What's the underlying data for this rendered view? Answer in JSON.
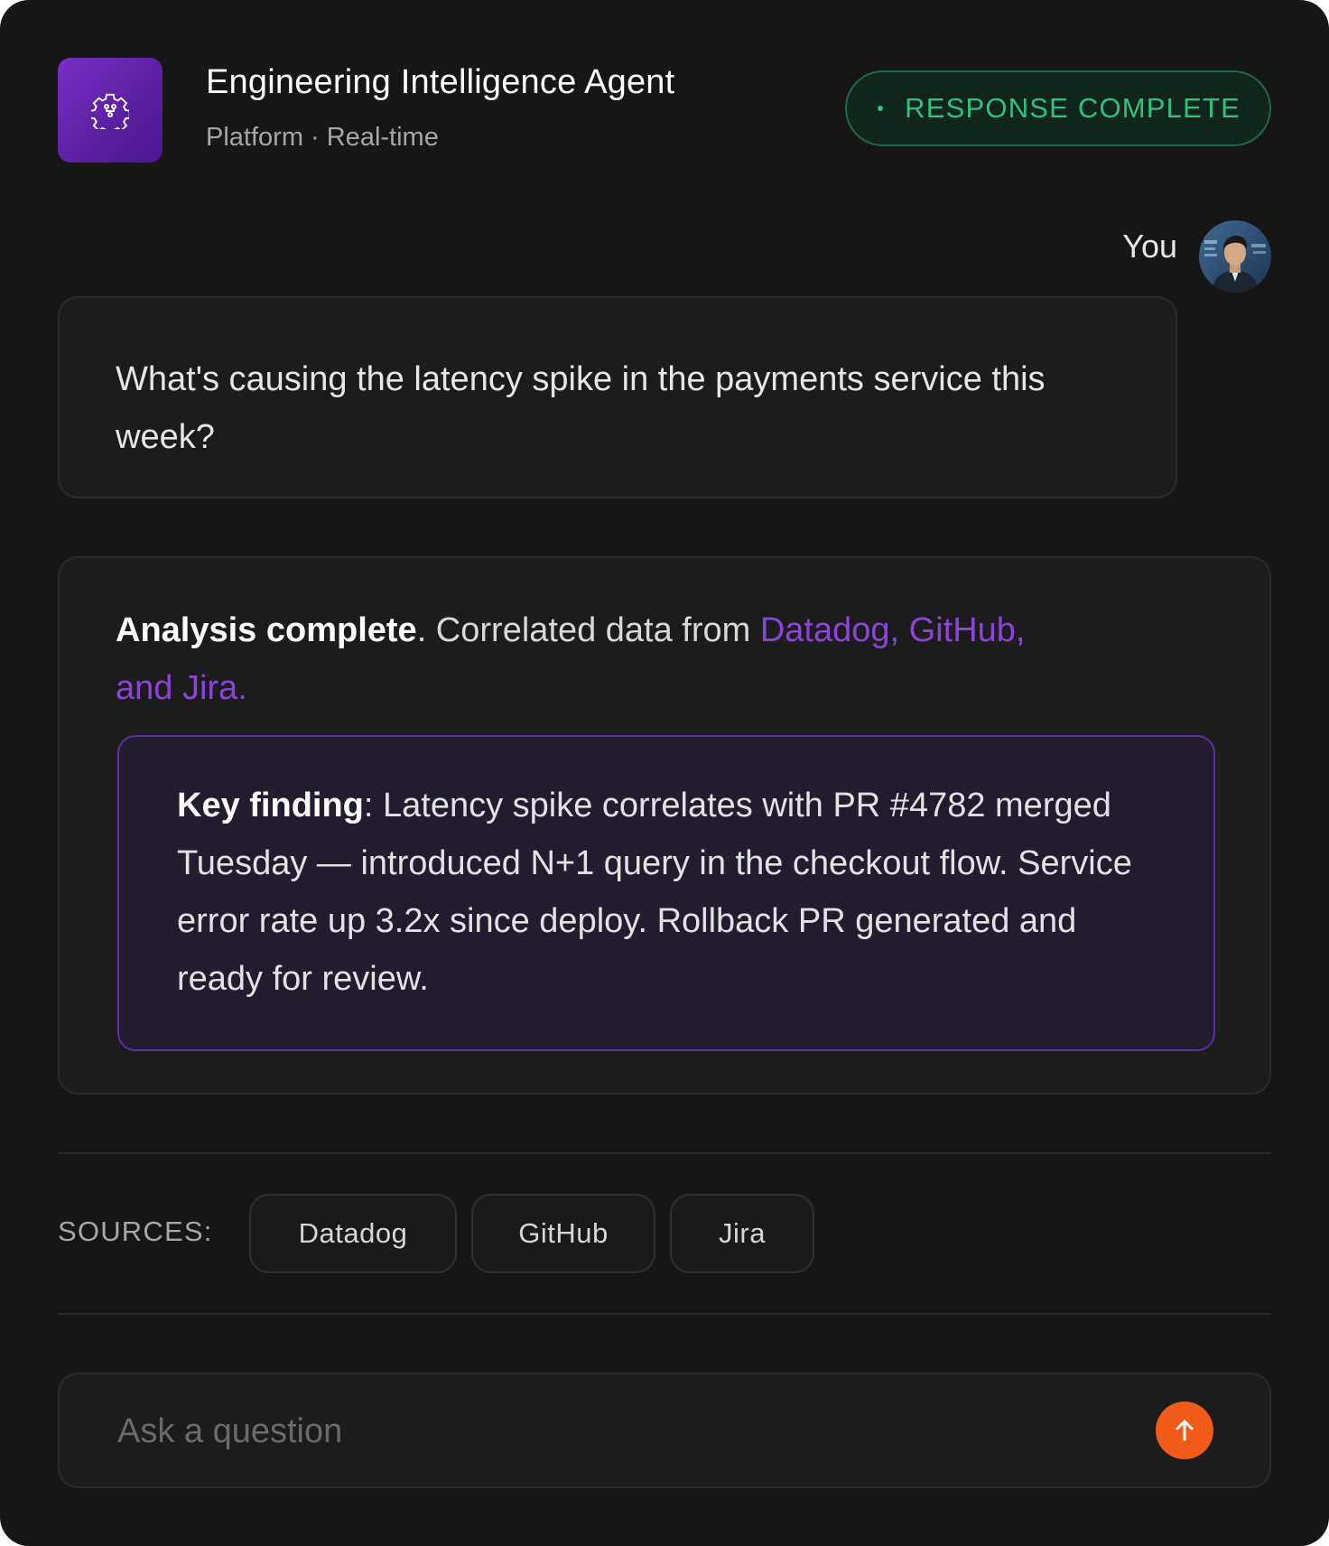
{
  "header": {
    "title": "Engineering Intelligence Agent",
    "subtitle": "Platform · Real-time",
    "app_icon": "gear-circuit-icon",
    "status": "RESPONSE COMPLETE",
    "status_color": "#2ec27e"
  },
  "user_message": {
    "author": "You",
    "avatar": "user-avatar",
    "text": "What's causing the latency spike in the payments service this week?"
  },
  "agent_response": {
    "summary_bold": "Analysis complete",
    "summary_text": ". Correlated data from ",
    "summary_sources": "Datadog, GitHub, and Jira.",
    "accent_color": "#8a44d8",
    "finding_label": "Key finding",
    "finding_text": ": Latency spike correlates with PR #4782 merged Tuesday — introduced N+1 query in the checkout flow. Service error rate up 3.2x since deploy. Rollback PR generated and ready for review."
  },
  "sources": {
    "label": "SOURCES:",
    "items": [
      "Datadog",
      "GitHub",
      "Jira"
    ]
  },
  "composer": {
    "placeholder": "Ask a question",
    "send_icon": "arrow-up-icon",
    "send_color": "#f25a1a"
  }
}
